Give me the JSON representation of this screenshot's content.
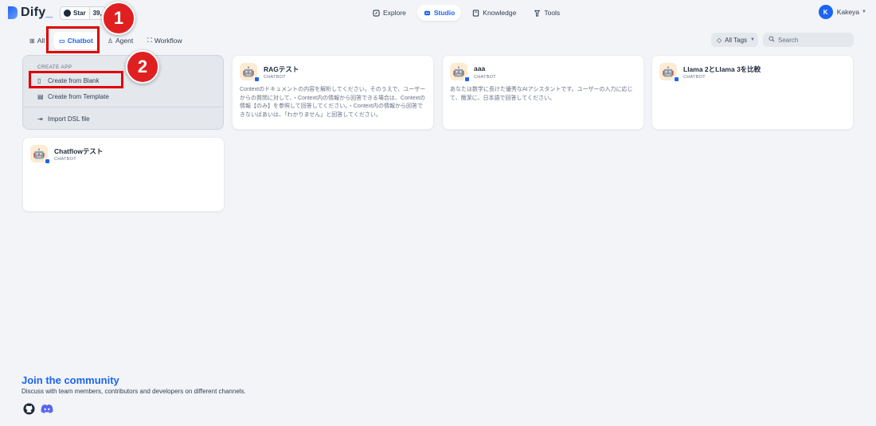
{
  "header": {
    "logo": "Dify",
    "github_star": {
      "label": "Star",
      "count": "39,"
    },
    "nav": [
      {
        "label": "Explore",
        "icon": "compass-icon"
      },
      {
        "label": "Studio",
        "icon": "studio-icon",
        "active": true
      },
      {
        "label": "Knowledge",
        "icon": "book-icon"
      },
      {
        "label": "Tools",
        "icon": "tools-icon"
      }
    ],
    "user": {
      "initial": "K",
      "name": "Kakeya"
    }
  },
  "tabs": [
    {
      "label": "All",
      "icon": "grid-icon"
    },
    {
      "label": "Chatbot",
      "icon": "chat-icon",
      "active": true
    },
    {
      "label": "Agent",
      "icon": "agent-icon"
    },
    {
      "label": "Workflow",
      "icon": "workflow-icon"
    }
  ],
  "filters": {
    "tags_label": "All Tags",
    "search_placeholder": "Search"
  },
  "create_app": {
    "title": "CREATE APP",
    "items": [
      "Create from Blank",
      "Create from Template",
      "Import DSL file"
    ]
  },
  "apps": [
    {
      "name": "RAGテスト",
      "type": "CHATBOT",
      "description": "Contextのドキュメントの内容を解析してください。そのうえで、ユーザーからの質問に対して、・Context内の情報から回答できる場合は、Contextの情報【のみ】を参照して回答してください。・Context内の情報から回答できないばあいは、「わかりません」と回答してください。"
    },
    {
      "name": "aaa",
      "type": "CHATBOT",
      "description": "あなたは数学に長けた優秀なAIアシスタントです。ユーザーの入力に応じて、簡潔に、日本語で回答してください。"
    },
    {
      "name": "Llama 2とLlama 3を比較",
      "type": "CHATBOT",
      "description": ""
    },
    {
      "name": "Chatflowテスト",
      "type": "CHATBOT",
      "description": ""
    }
  ],
  "annotations": [
    "1",
    "2"
  ],
  "community": {
    "title": "Join the community",
    "description": "Discuss with team members, contributors and developers on different channels."
  },
  "colors": {
    "accent": "#1c64f2",
    "highlight": "#e00000",
    "background": "#f2f4f7"
  }
}
